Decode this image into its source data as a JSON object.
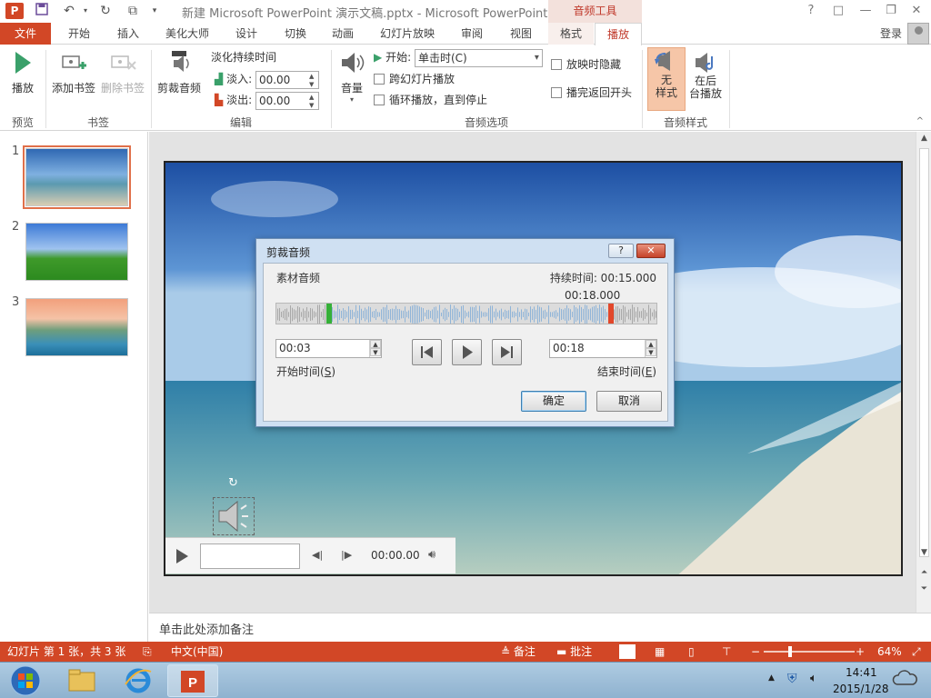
{
  "app": {
    "title": "新建 Microsoft PowerPoint 演示文稿.pptx - Microsoft PowerPoint",
    "context_tab_header": "音频工具",
    "login": "登录",
    "window_controls": [
      "?",
      "□",
      "—",
      "❐",
      "✕"
    ]
  },
  "tabs": [
    {
      "label": "文件"
    },
    {
      "label": "开始"
    },
    {
      "label": "插入"
    },
    {
      "label": "美化大师"
    },
    {
      "label": "设计"
    },
    {
      "label": "切换"
    },
    {
      "label": "动画"
    },
    {
      "label": "幻灯片放映"
    },
    {
      "label": "审阅"
    },
    {
      "label": "视图"
    },
    {
      "label": "格式"
    },
    {
      "label": "播放"
    }
  ],
  "ribbon": {
    "play": "播放",
    "add_bookmark": "添加书签",
    "remove_bookmark": "删除书签",
    "trim_audio": "剪裁音频",
    "fade_title": "淡化持续时间",
    "fade_in_label": "淡入:",
    "fade_in_value": "00.00",
    "fade_out_label": "淡出:",
    "fade_out_value": "00.00",
    "volume": "音量",
    "start_label": "开始:",
    "start_value": "单击时(C)",
    "play_across_slides": "跨幻灯片播放",
    "loop_until_stopped": "循环播放，直到停止",
    "hide_during_show": "放映时隐藏",
    "rewind_after_playing": "播完返回开头",
    "no_style_line1": "无",
    "no_style_line2": "样式",
    "play_background_line1": "在后",
    "play_background_line2": "台播放",
    "groups": {
      "preview": "预览",
      "bookmarks": "书签",
      "editing": "编辑",
      "audio_options": "音频选项",
      "audio_styles": "音频样式"
    }
  },
  "slides": [
    {
      "number": "1"
    },
    {
      "number": "2"
    },
    {
      "number": "3"
    }
  ],
  "dialog": {
    "title": "剪裁音频",
    "help": "?",
    "close": "✕",
    "source_label": "素材音频",
    "duration_label": "持续时间: 00:15.000",
    "end_marker_time": "00:18.000",
    "start_time_value": "00:03",
    "start_time_label": "开始时间(",
    "start_time_key": "S",
    "end_time_value": "00:18",
    "end_time_label": "结束时间(",
    "end_time_key": "E",
    "close_paren": ")",
    "ok": "确定",
    "cancel": "取消",
    "start_marker_fraction": 0.138,
    "end_marker_fraction": 0.877
  },
  "player": {
    "time": "00:00.00"
  },
  "notes": {
    "placeholder": "单击此处添加备注"
  },
  "status": {
    "slide_info": "幻灯片 第 1 张，共 3 张",
    "language": "中文(中国)",
    "notes": "备注",
    "comments": "批注",
    "zoom": "64%"
  },
  "taskbar": {
    "time": "14:41",
    "date": "2015/1/28"
  },
  "colors": {
    "accent": "#d24726",
    "dialog_frame": "#cfe0f2"
  }
}
